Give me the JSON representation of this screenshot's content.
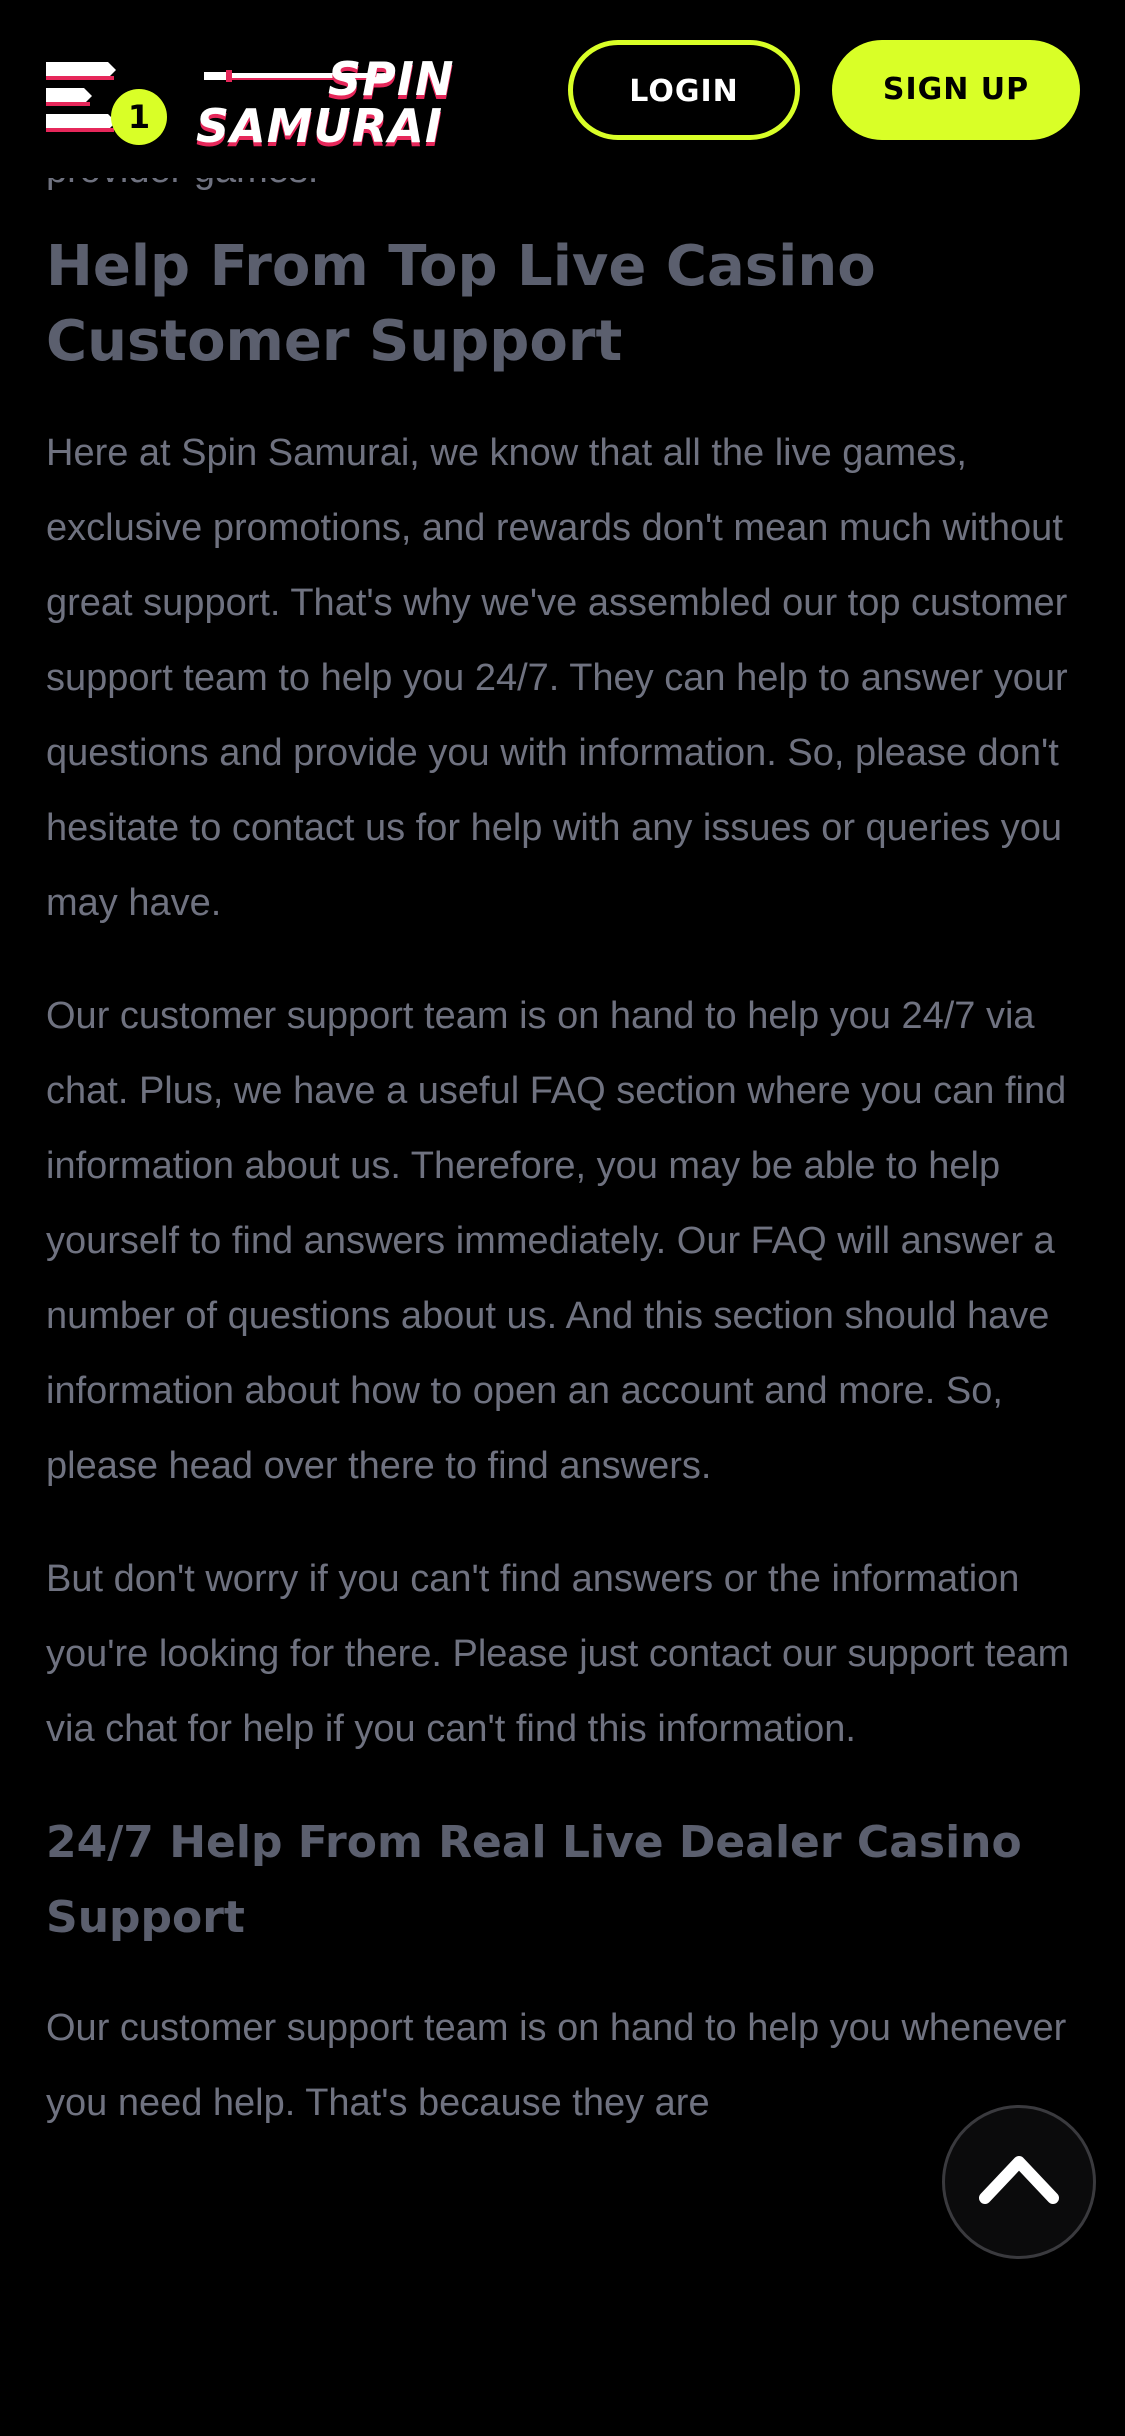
{
  "header": {
    "menu_badge": "1",
    "logo": {
      "line1": "SPIN",
      "line2": "SAMURAI"
    },
    "login_label": "LOGIN",
    "signup_label": "SIGN UP",
    "accent_color": "#d9ff27",
    "brand_color": "#e6275a"
  },
  "article": {
    "cut_text": "provider games!",
    "heading_support": "Help From Top Live Casino Customer Support",
    "paragraph_1": "Here at Spin Samurai, we know that all the live games, exclusive promotions, and rewards don't mean much without great support. That's why we've assembled our top customer support team to help you 24/7. They can help to answer your questions and provide you with information. So, please don't hesitate to contact us for help with any issues or queries you may have.",
    "paragraph_2": "Our customer support team is on hand to help you 24/7 via chat. Plus, we have a useful FAQ section where you can find information about us. Therefore, you may be able to help yourself to find answers immediately. Our FAQ will answer a number of questions about us. And this section should have information about how to open an account and more. So, please head over there to find answers.",
    "paragraph_3": "But don't worry if you can't find answers or the information you're looking for there. Please just contact our support team via chat for help if you can't find this information.",
    "heading_dealer": "24/7 Help From Real Live Dealer Casino Support",
    "paragraph_4": "Our customer support team is on hand to help you whenever you need help. That's because they are"
  },
  "icons": {
    "menu": "menu-icon",
    "scroll_top": "chevron-up-icon"
  }
}
